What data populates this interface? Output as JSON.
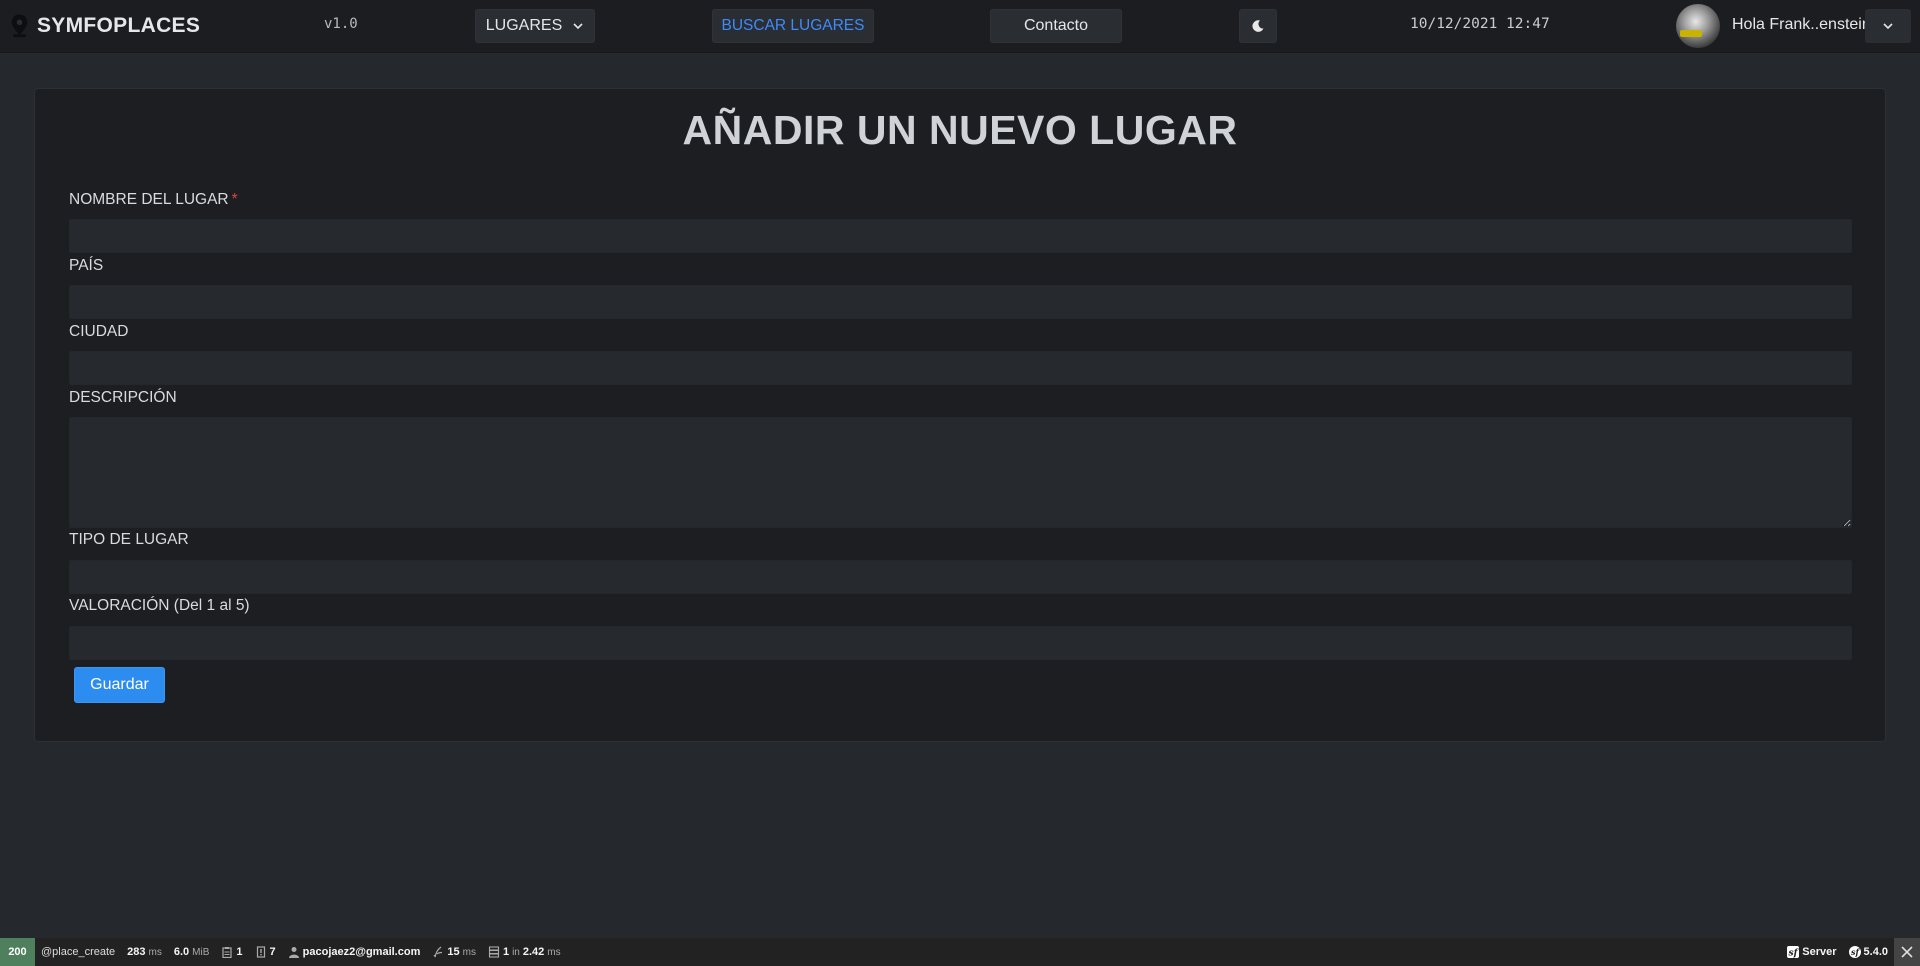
{
  "navbar": {
    "brand": "SYMFOPLACES",
    "version": "v1.0",
    "lugares_label": "LUGARES",
    "buscar_label": "BUSCAR LUGARES",
    "contacto_label": "Contacto",
    "datetime": "10/12/2021 12:47",
    "greeting": "Hola Frank..enstein",
    "icons": {
      "brand": "map-pin-icon",
      "theme": "moon-icon",
      "dropdown": "chevron-down-icon"
    }
  },
  "form": {
    "title": "AÑADIR UN NUEVO LUGAR",
    "fields": [
      {
        "label": "NOMBRE DEL LUGAR",
        "required_mark": "*",
        "value": ""
      },
      {
        "label": "PAÍS",
        "value": ""
      },
      {
        "label": "CIUDAD",
        "value": ""
      },
      {
        "label": "DESCRIPCIÓN",
        "value": ""
      },
      {
        "label": "TIPO DE LUGAR",
        "value": ""
      },
      {
        "label": "VALORACIÓN (Del 1 al 5)",
        "value": ""
      }
    ],
    "submit_label": "Guardar"
  },
  "debug_toolbar": {
    "status": "200",
    "route": "@place_create",
    "time_value": "283",
    "time_unit": "ms",
    "memory_value": "6.0",
    "memory_unit": "MiB",
    "forms_count": "1",
    "validator_count": "7",
    "user": "pacojaez2@gmail.com",
    "twig_value": "15",
    "twig_unit": "ms",
    "db_queries": "1",
    "db_in": "in",
    "db_time": "2.42",
    "db_unit": "ms",
    "server_label": "Server",
    "symfony_version": "5.4.0",
    "colors": {
      "status_ok": "#4f805d",
      "background": "#222222"
    }
  },
  "colors": {
    "page_bg": "#25282d",
    "navbar_bg": "#1b1d21",
    "card_bg": "#1c1e22",
    "accent": "#2d8cf0",
    "link": "#3d8bfd",
    "required": "#e0443e"
  }
}
